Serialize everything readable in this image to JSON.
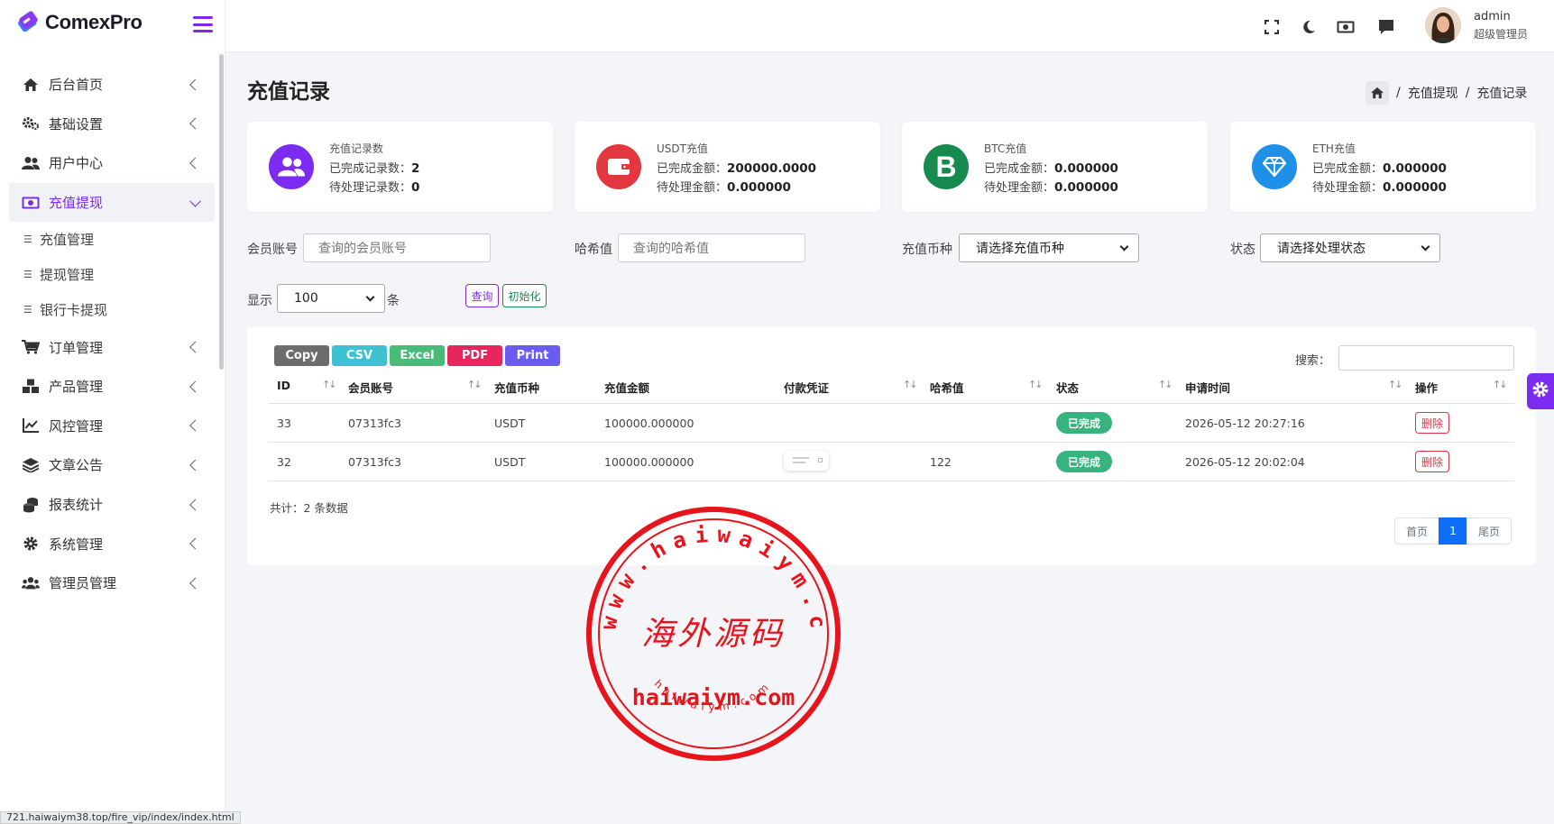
{
  "brand": {
    "name": "ComexPro"
  },
  "sidebar": {
    "items": [
      {
        "label": "后台首页",
        "icon": "home-icon"
      },
      {
        "label": "基础设置",
        "icon": "cogs-icon"
      },
      {
        "label": "用户中心",
        "icon": "users-icon"
      },
      {
        "label": "充值提现",
        "icon": "money-icon",
        "active": true
      },
      {
        "label": "订单管理",
        "icon": "cart-icon"
      },
      {
        "label": "产品管理",
        "icon": "cubes-icon"
      },
      {
        "label": "风控管理",
        "icon": "chart-line-icon"
      },
      {
        "label": "文章公告",
        "icon": "layers-icon"
      },
      {
        "label": "报表统计",
        "icon": "coins-icon"
      },
      {
        "label": "系统管理",
        "icon": "gear-icon"
      },
      {
        "label": "管理员管理",
        "icon": "user-group-icon"
      }
    ],
    "subitems": [
      {
        "label": "充值管理"
      },
      {
        "label": "提现管理"
      },
      {
        "label": "银行卡提现"
      }
    ]
  },
  "header": {
    "icons": [
      "fullscreen-icon",
      "moon-icon",
      "money-icon",
      "chat-icon"
    ],
    "user": {
      "name": "admin",
      "role": "超级管理员"
    }
  },
  "page": {
    "title": "充值记录",
    "breadcrumb": [
      "充值提现",
      "充值记录"
    ]
  },
  "cards": [
    {
      "title": "充值记录数",
      "line1_label": "已完成记录数：",
      "line1_value": "2",
      "line2_label": "待处理记录数：",
      "line2_value": "0",
      "color": "#7b2cf0",
      "icon": "users-icon"
    },
    {
      "title": "USDT充值",
      "line1_label": "已完成金额：",
      "line1_value": "200000.0000",
      "line2_label": "待处理金额：",
      "line2_value": "0.000000",
      "color": "#e0383e",
      "icon": "wallet-icon"
    },
    {
      "title": "BTC充值",
      "line1_label": "已完成金额：",
      "line1_value": "0.000000",
      "line2_label": "待处理金额：",
      "line2_value": "0.000000",
      "color": "#178a4f",
      "icon": "bitcoin-icon"
    },
    {
      "title": "ETH充值",
      "line1_label": "已完成金额：",
      "line1_value": "0.000000",
      "line2_label": "待处理金额：",
      "line2_value": "0.000000",
      "color": "#1e90e8",
      "icon": "diamond-icon"
    }
  ],
  "filters": {
    "member_label": "会员账号",
    "member_placeholder": "查询的会员账号",
    "hash_label": "哈希值",
    "hash_placeholder": "查询的哈希值",
    "coin_label": "充值币种",
    "coin_select": "请选择充值币种",
    "status_label": "状态",
    "status_select": "请选择处理状态",
    "show_label": "显示",
    "show_value": "100",
    "show_suffix": "条",
    "query_button": "查询",
    "reset_button": "初始化"
  },
  "table": {
    "export_buttons": [
      {
        "label": "Copy",
        "color": "#6c6c6c"
      },
      {
        "label": "CSV",
        "color": "#3ec1d3"
      },
      {
        "label": "Excel",
        "color": "#48bb78"
      },
      {
        "label": "PDF",
        "color": "#e8265e"
      },
      {
        "label": "Print",
        "color": "#6a5cf0"
      }
    ],
    "search_label": "搜索：",
    "columns": [
      "ID",
      "会员账号",
      "充值币种",
      "充值金额",
      "付款凭证",
      "哈希值",
      "状态",
      "申请时间",
      "操作"
    ],
    "rows": [
      {
        "id": "33",
        "member": "07313fc3",
        "coin": "USDT",
        "amount": "100000.000000",
        "hash": "",
        "status": "已完成",
        "time": "2026-05-12 20:27:16",
        "action": "删除"
      },
      {
        "id": "32",
        "member": "07313fc3",
        "coin": "USDT",
        "amount": "100000.000000",
        "hash": "122",
        "status": "已完成",
        "time": "2026-05-12 20:02:04",
        "action": "删除"
      }
    ],
    "total_text": "共计：2 条数据",
    "pagination": {
      "first": "首页",
      "current": "1",
      "last": "尾页"
    }
  },
  "watermark": {
    "top": "www.haiwaiym.com",
    "center": "海外源码",
    "bottom": "haiwaiym.com",
    "ring": "haiwaiym.com"
  },
  "status_url": "721.haiwaiym38.top/fire_vip/index/index.html"
}
